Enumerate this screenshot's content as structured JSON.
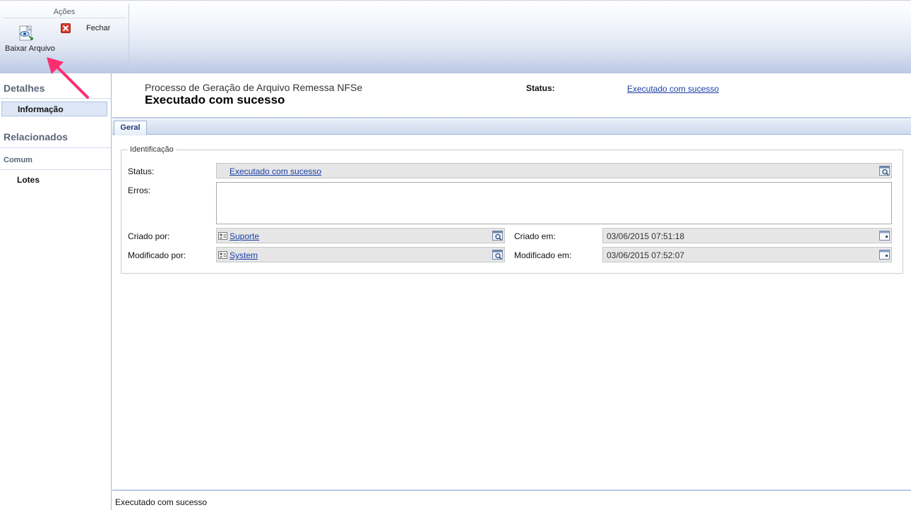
{
  "ribbon": {
    "group_label": "Ações",
    "download_label": "Baixar Arquivo",
    "download_icon": "download-file-icon",
    "close_label": "Fechar",
    "close_icon": "close-icon",
    "close_color": "#d83a2a"
  },
  "sidebar": {
    "details_heading": "Detalhes",
    "info_item": "Informação",
    "related_heading": "Relacionados",
    "common_heading": "Comum",
    "lots_item": "Lotes"
  },
  "header": {
    "entity_type": "Processo de Geração de Arquivo Remessa NFSe",
    "record_title": "Executado com sucesso",
    "status_label": "Status:",
    "status_value": "Executado com sucesso"
  },
  "tabs": [
    {
      "label": "Geral"
    }
  ],
  "form": {
    "section_legend": "Identificação",
    "status_label": "Status:",
    "status_value": "Executado com sucesso",
    "errors_label": "Erros:",
    "errors_value": "",
    "created_by_label": "Criado por:",
    "created_by_value": "Suporte",
    "modified_by_label": "Modificado por:",
    "modified_by_value": "System",
    "created_on_label": "Criado em:",
    "created_on_value": "03/06/2015 07:51:18",
    "modified_on_label": "Modificado em:",
    "modified_on_value": "03/06/2015 07:52:07"
  },
  "statusbar": {
    "text": "Executado com sucesso"
  },
  "colors": {
    "accent": "#1a3fa6",
    "annotation_arrow": "#ff2d6f"
  }
}
